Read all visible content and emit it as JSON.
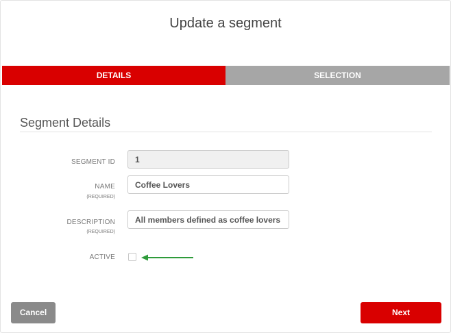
{
  "dialog": {
    "title": "Update a segment"
  },
  "tabs": [
    {
      "label": "DETAILS",
      "active": true
    },
    {
      "label": "SELECTION",
      "active": false
    }
  ],
  "section": {
    "title": "Segment Details"
  },
  "form": {
    "segment_id": {
      "label": "SEGMENT ID",
      "value": "1"
    },
    "name": {
      "label": "NAME",
      "required": "(REQUIRED)",
      "value": "Coffee Lovers"
    },
    "description": {
      "label": "DESCRIPTION",
      "required": "(REQUIRED)",
      "value": "All members defined as coffee lovers"
    },
    "active": {
      "label": "ACTIVE",
      "checked": false
    }
  },
  "buttons": {
    "cancel": "Cancel",
    "next": "Next"
  },
  "colors": {
    "primary": "#d90000",
    "tab_inactive": "#a6a6a6",
    "cancel_button": "#8a8a8a",
    "annotation_arrow": "#2e9b3a"
  },
  "annotation": {
    "icon": "arrow-left-icon"
  }
}
